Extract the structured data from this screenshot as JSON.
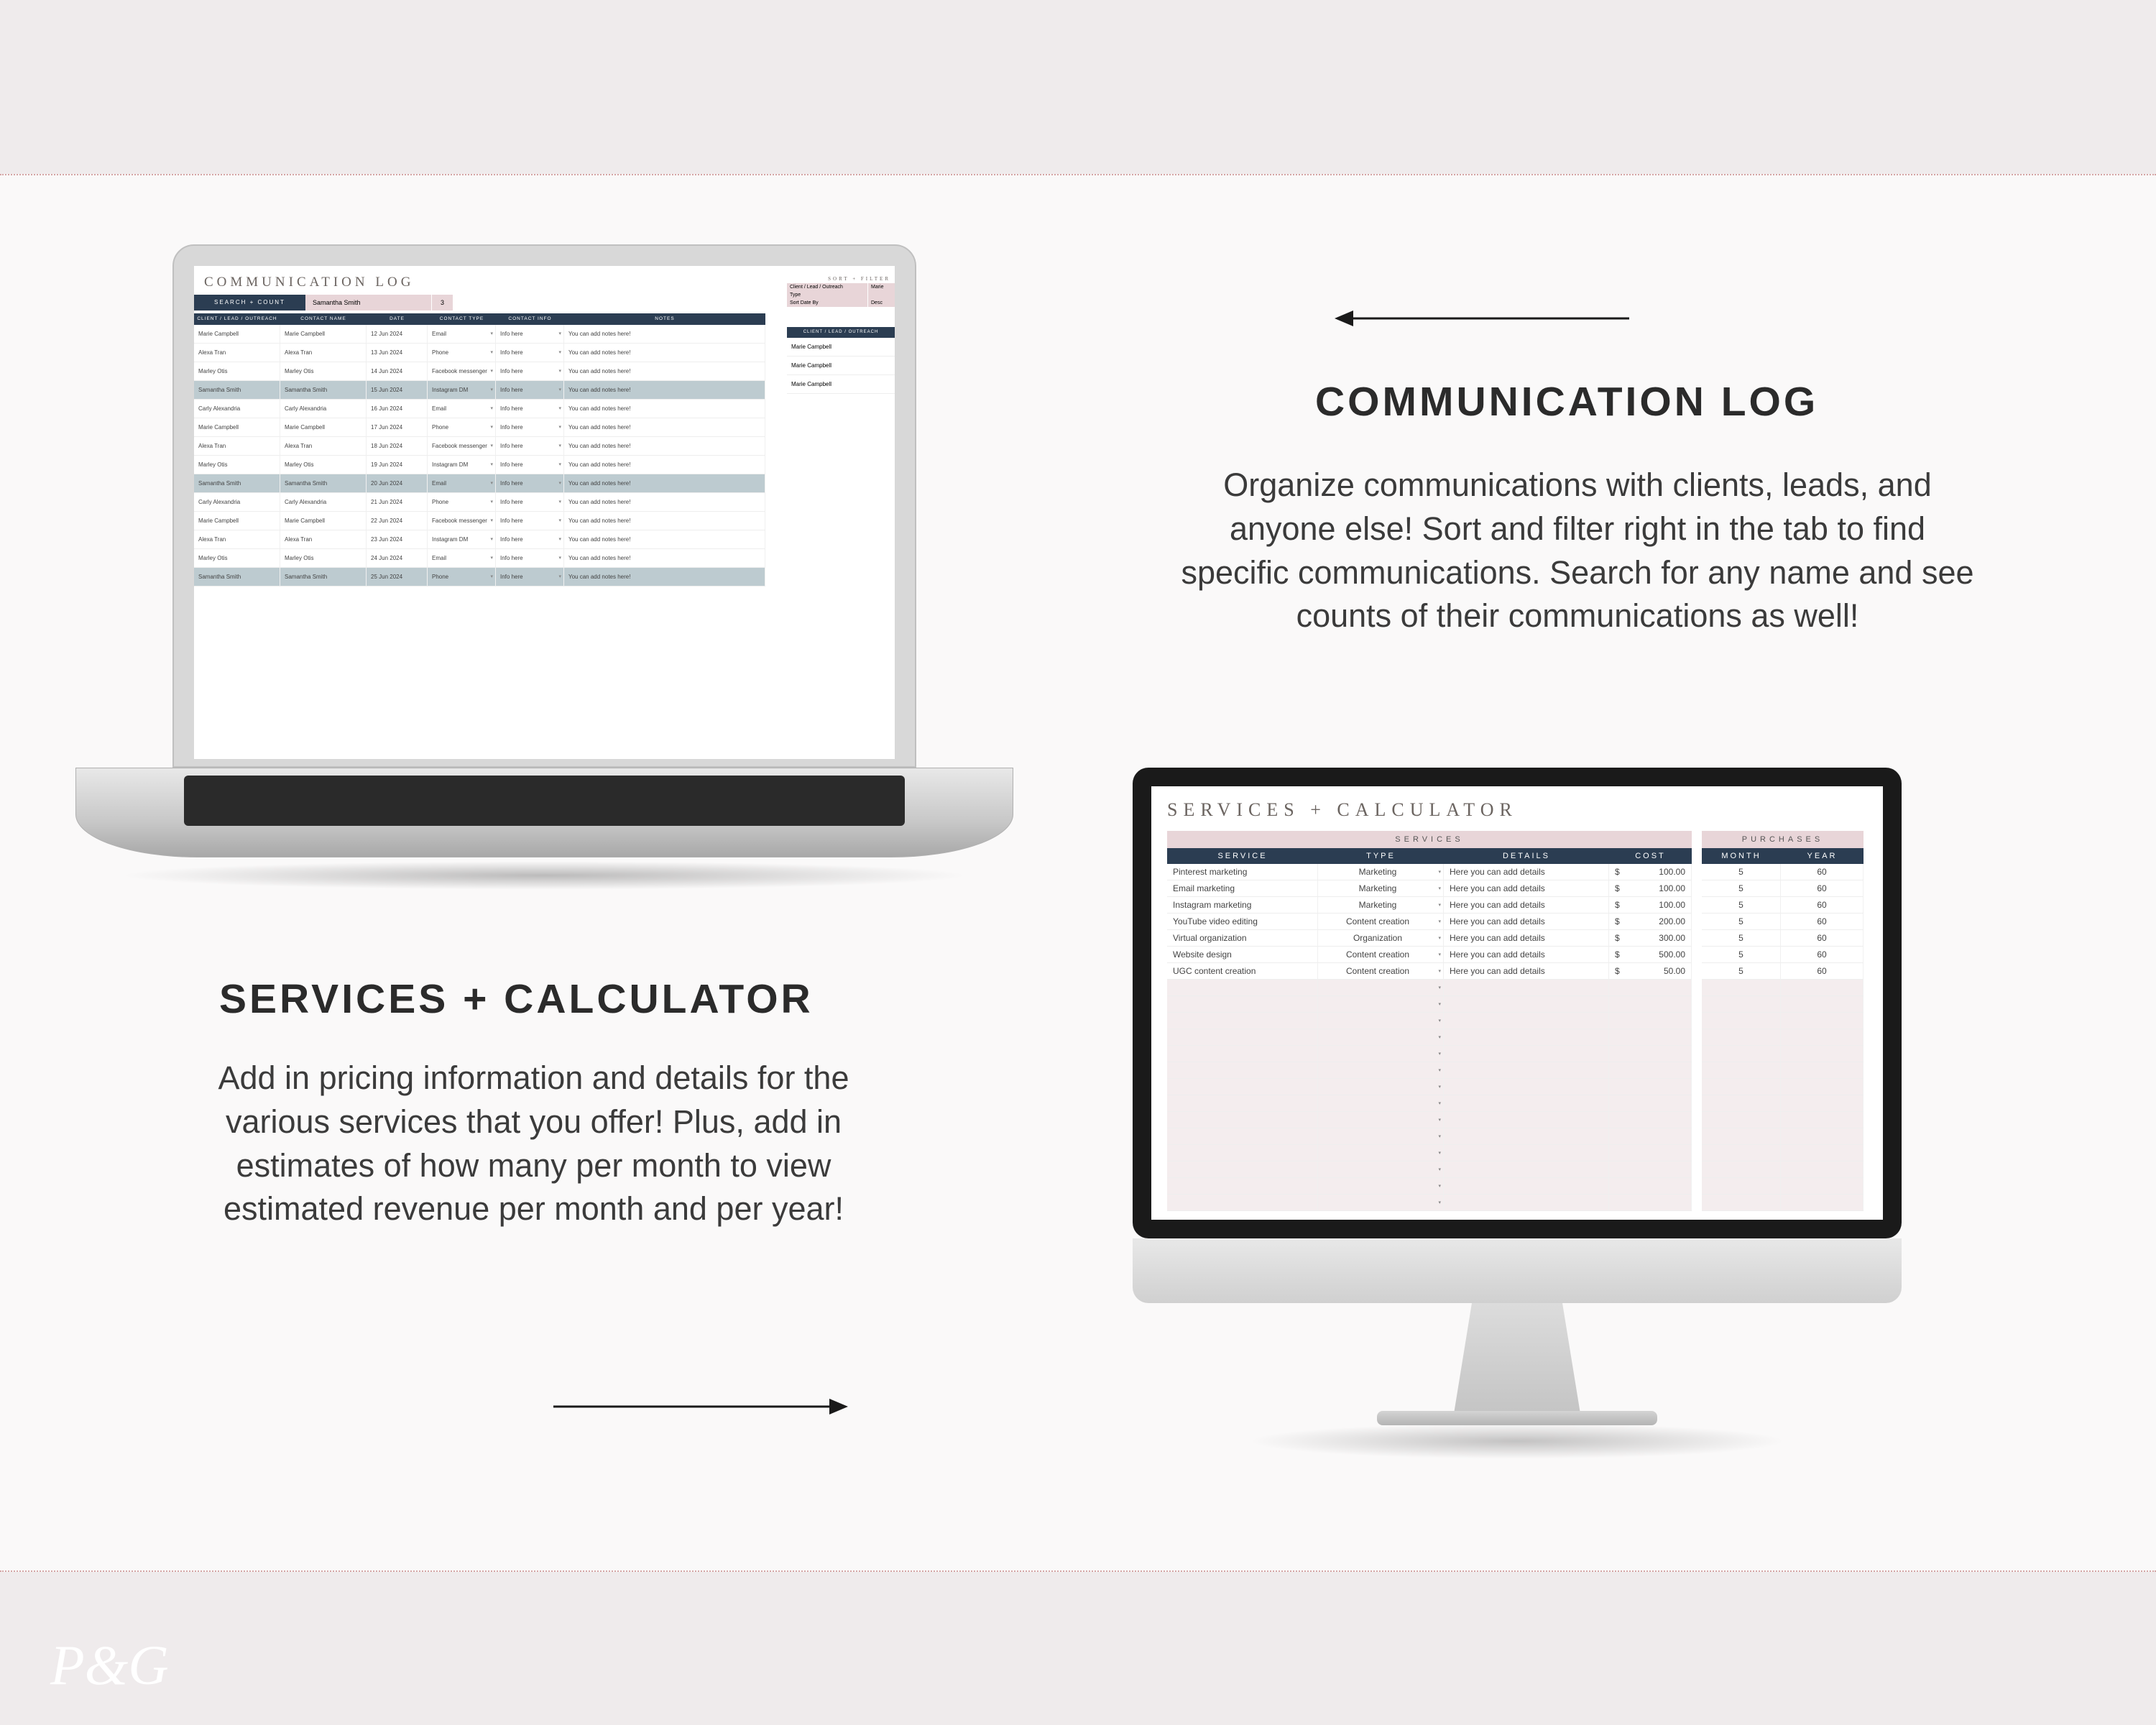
{
  "logo": "P&G",
  "comm_section": {
    "title": "COMMUNICATION LOG",
    "paragraph": "Organize communications with clients, leads, and anyone else! Sort and filter right in the tab to find specific communications. Search for any name and see counts of their communications as well!"
  },
  "serv_section": {
    "title": "SERVICES + CALCULATOR",
    "paragraph": "Add in pricing information and details for the various services that you offer! Plus, add in estimates of how many per month to view estimated revenue per month and per year!"
  },
  "comm_log": {
    "sheet_title": "COMMUNICATION LOG",
    "search_label": "SEARCH + COUNT",
    "search_value": "Samantha Smith",
    "search_count": "3",
    "sort_title": "SORT + FILTER",
    "sort_rows": [
      {
        "k": "Client / Lead / Outreach",
        "v": "Marie"
      },
      {
        "k": "Type",
        "v": ""
      },
      {
        "k": "Sort Date By",
        "v": "Desc"
      }
    ],
    "right_header": "CLIENT / LEAD / OUTREACH",
    "right_items": [
      "Marie Campbell",
      "Marie Campbell",
      "Marie Campbell"
    ],
    "columns": {
      "a": "CLIENT / LEAD / OUTREACH",
      "b": "CONTACT NAME",
      "c": "DATE",
      "d": "CONTACT TYPE",
      "e": "CONTACT INFO",
      "f": "NOTES"
    },
    "rows": [
      {
        "a": "Marie Campbell",
        "b": "Marie Campbell",
        "c": "12 Jun 2024",
        "d": "Email",
        "e": "Info here",
        "f": "You can add notes here!",
        "hl": false
      },
      {
        "a": "Alexa Tran",
        "b": "Alexa Tran",
        "c": "13 Jun 2024",
        "d": "Phone",
        "e": "Info here",
        "f": "You can add notes here!",
        "hl": false
      },
      {
        "a": "Marley Otis",
        "b": "Marley Otis",
        "c": "14 Jun 2024",
        "d": "Facebook messenger",
        "e": "Info here",
        "f": "You can add notes here!",
        "hl": false
      },
      {
        "a": "Samantha Smith",
        "b": "Samantha Smith",
        "c": "15 Jun 2024",
        "d": "Instagram DM",
        "e": "Info here",
        "f": "You can add notes here!",
        "hl": true
      },
      {
        "a": "Carly Alexandria",
        "b": "Carly Alexandria",
        "c": "16 Jun 2024",
        "d": "Email",
        "e": "Info here",
        "f": "You can add notes here!",
        "hl": false
      },
      {
        "a": "Marie Campbell",
        "b": "Marie Campbell",
        "c": "17 Jun 2024",
        "d": "Phone",
        "e": "Info here",
        "f": "You can add notes here!",
        "hl": false
      },
      {
        "a": "Alexa Tran",
        "b": "Alexa Tran",
        "c": "18 Jun 2024",
        "d": "Facebook messenger",
        "e": "Info here",
        "f": "You can add notes here!",
        "hl": false
      },
      {
        "a": "Marley Otis",
        "b": "Marley Otis",
        "c": "19 Jun 2024",
        "d": "Instagram DM",
        "e": "Info here",
        "f": "You can add notes here!",
        "hl": false
      },
      {
        "a": "Samantha Smith",
        "b": "Samantha Smith",
        "c": "20 Jun 2024",
        "d": "Email",
        "e": "Info here",
        "f": "You can add notes here!",
        "hl": true
      },
      {
        "a": "Carly Alexandria",
        "b": "Carly Alexandria",
        "c": "21 Jun 2024",
        "d": "Phone",
        "e": "Info here",
        "f": "You can add notes here!",
        "hl": false
      },
      {
        "a": "Marie Campbell",
        "b": "Marie Campbell",
        "c": "22 Jun 2024",
        "d": "Facebook messenger",
        "e": "Info here",
        "f": "You can add notes here!",
        "hl": false
      },
      {
        "a": "Alexa Tran",
        "b": "Alexa Tran",
        "c": "23 Jun 2024",
        "d": "Instagram DM",
        "e": "Info here",
        "f": "You can add notes here!",
        "hl": false
      },
      {
        "a": "Marley Otis",
        "b": "Marley Otis",
        "c": "24 Jun 2024",
        "d": "Email",
        "e": "Info here",
        "f": "You can add notes here!",
        "hl": false
      },
      {
        "a": "Samantha Smith",
        "b": "Samantha Smith",
        "c": "25 Jun 2024",
        "d": "Phone",
        "e": "Info here",
        "f": "You can add notes here!",
        "hl": true
      }
    ]
  },
  "services": {
    "sheet_title": "SERVICES + CALCULATOR",
    "left_label": "SERVICES",
    "right_label": "PURCHASES",
    "columns": {
      "name": "SERVICE",
      "type": "TYPE",
      "det": "DETAILS",
      "cost": "COST",
      "mon": "MONTH",
      "yr": "YEAR"
    },
    "rows": [
      {
        "name": "Pinterest marketing",
        "type": "Marketing",
        "det": "Here you can add details",
        "cost": "100.00",
        "mon": "5",
        "yr": "60"
      },
      {
        "name": "Email marketing",
        "type": "Marketing",
        "det": "Here you can add details",
        "cost": "100.00",
        "mon": "5",
        "yr": "60"
      },
      {
        "name": "Instagram marketing",
        "type": "Marketing",
        "det": "Here you can add details",
        "cost": "100.00",
        "mon": "5",
        "yr": "60"
      },
      {
        "name": "YouTube video editing",
        "type": "Content creation",
        "det": "Here you can add details",
        "cost": "200.00",
        "mon": "5",
        "yr": "60"
      },
      {
        "name": "Virtual organization",
        "type": "Organization",
        "det": "Here you can add details",
        "cost": "300.00",
        "mon": "5",
        "yr": "60"
      },
      {
        "name": "Website design",
        "type": "Content creation",
        "det": "Here you can add details",
        "cost": "500.00",
        "mon": "5",
        "yr": "60"
      },
      {
        "name": "UGC content creation",
        "type": "Content creation",
        "det": "Here you can add details",
        "cost": "50.00",
        "mon": "5",
        "yr": "60"
      }
    ],
    "empty_rows": 14
  }
}
